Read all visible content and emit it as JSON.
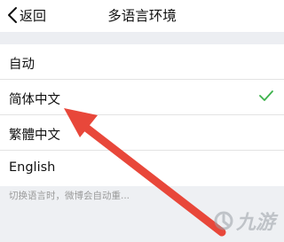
{
  "navbar": {
    "back_label": "返回",
    "title": "多语言环境"
  },
  "languages": [
    {
      "label": "自动",
      "selected": false
    },
    {
      "label": "简体中文",
      "selected": true
    },
    {
      "label": "繁體中文",
      "selected": false
    },
    {
      "label": "English",
      "selected": false
    }
  ],
  "footer": {
    "hint": "切换语言时，微博会自动重..."
  },
  "watermark": {
    "text": "九游"
  },
  "colors": {
    "check": "#3db24c",
    "arrow": "#e8473a",
    "section_gap": "#eceef2",
    "hint_text": "#9a9a9a"
  },
  "icons": {
    "back": "chevron-left-icon",
    "selected": "check-icon",
    "annotation": "arrow-annotation",
    "watermark": "watermark-logo-icon"
  }
}
